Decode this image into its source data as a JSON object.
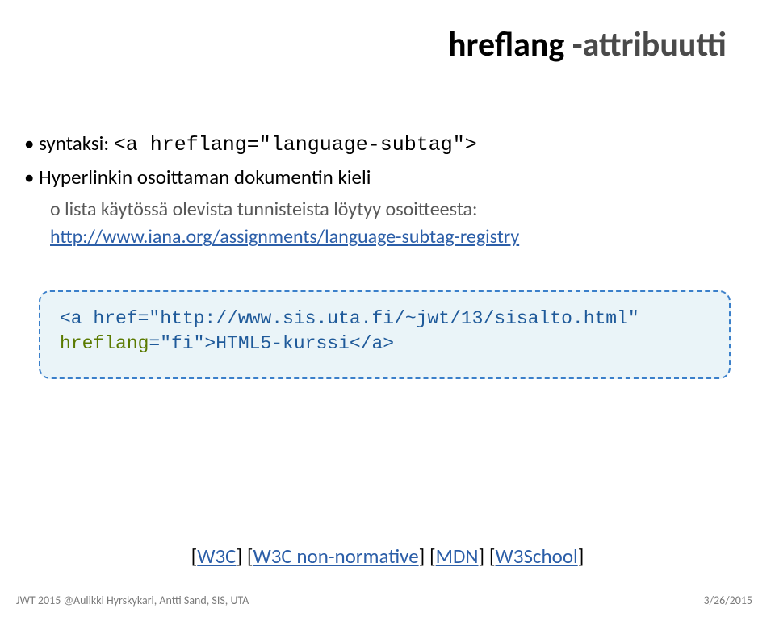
{
  "title": {
    "keyword": "hreflang",
    "rest": " -attribuutti"
  },
  "bullets": {
    "syntax": {
      "label": "syntaksi:",
      "code": "<a hreflang=\"language-subtag\">"
    },
    "meaning": "Hyperlinkin osoittaman dokumentin kieli",
    "sub": {
      "text": "lista käytössä olevista tunnisteista löytyy osoitteesta:",
      "url": "http://www.iana.org/assignments/language-subtag-registry"
    }
  },
  "codebox": {
    "line1_a": "<a href=\"http://www.sis.uta.fi/~jwt/13/sisalto.html\"",
    "line2_attr": "hreflang",
    "line2_rest": "=\"fi\">HTML5-kurssi</a>"
  },
  "footer_links": {
    "w3c": "W3C",
    "w3c_nn": "W3C non-normative",
    "mdn": "MDN",
    "w3school": "W3School"
  },
  "footer_left": "JWT 2015 @Aulikki Hyrskykari, Antti Sand, SIS, UTA",
  "footer_right": "3/26/2015"
}
